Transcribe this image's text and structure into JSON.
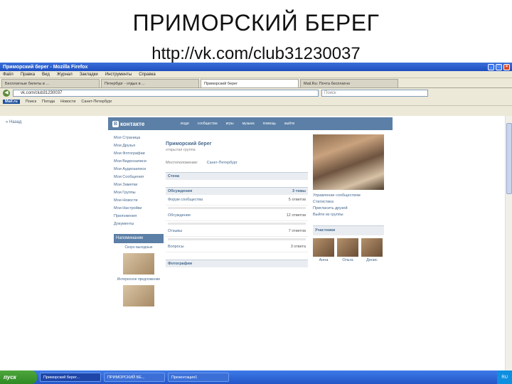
{
  "slide": {
    "title": "ПРИМОРСКИЙ БЕРЕГ",
    "url": "http://vk.com/club31230037"
  },
  "browser": {
    "window_title": "Приморский берег - Mozilla Firefox",
    "menu": [
      "Файл",
      "Правка",
      "Вид",
      "Журнал",
      "Закладки",
      "Инструменты",
      "Справка"
    ],
    "tabs": [
      "Бесплатные билеты в ...",
      "Петербург - отдых в ...",
      "Приморский берег",
      "Mail.Ru: Почта бесплатно"
    ],
    "address": "vk.com/club31230037",
    "search_placeholder": "Поиск",
    "bookmarks": [
      "Mail.ru",
      "Поиск",
      "Погода",
      "Новости",
      "Санкт-Петербург"
    ]
  },
  "page": {
    "back_link": "« Назад",
    "vk_logo": "контакте",
    "vk_logo_letter": "В",
    "vk_nav": [
      "люди",
      "сообщества",
      "игры",
      "музыка",
      "помощь",
      "выйти"
    ],
    "side_menu": [
      "Моя Страница",
      "Мои Друзья",
      "Мои Фотографии",
      "Мои Видеозаписи",
      "Мои Аудиозаписи",
      "Мои Сообщения",
      "Мои Заметки",
      "Мои Группы",
      "Мои Новости",
      "Мои Настройки",
      "Приложения",
      "Документы"
    ],
    "side_block_title": "Напоминание",
    "side_text_1": "Скоро выходные",
    "side_text_2": "Интересное предложение",
    "group_name": "Приморский берег",
    "group_sub": "открытая группа",
    "info_label": "Местоположение:",
    "info_value": "Санкт-Петербург",
    "wall_title": "Стена",
    "forum_title": "Обсуждения",
    "forum_count": "3 темы",
    "forum_rows": [
      {
        "title": "Форум сообщества",
        "count": "5 ответов"
      },
      {
        "title": "Обсуждение",
        "count": "12 ответов"
      },
      {
        "title": "Отзывы",
        "count": "7 ответов"
      },
      {
        "title": "Вопросы",
        "count": "3 ответа"
      }
    ],
    "photos_title": "Фотографии",
    "right_links": [
      "Управление сообществом",
      "Статистика",
      "Пригласить друзей",
      "Выйти из группы"
    ],
    "members_title": "Участники",
    "members": [
      "Анна",
      "Ольга",
      "Денис"
    ]
  },
  "taskbar": {
    "start": "пуск",
    "items": [
      "Приморский берег...",
      "ПРИМОРСКИЙ БЕ...",
      "Презентация1"
    ],
    "clock": "RU"
  }
}
